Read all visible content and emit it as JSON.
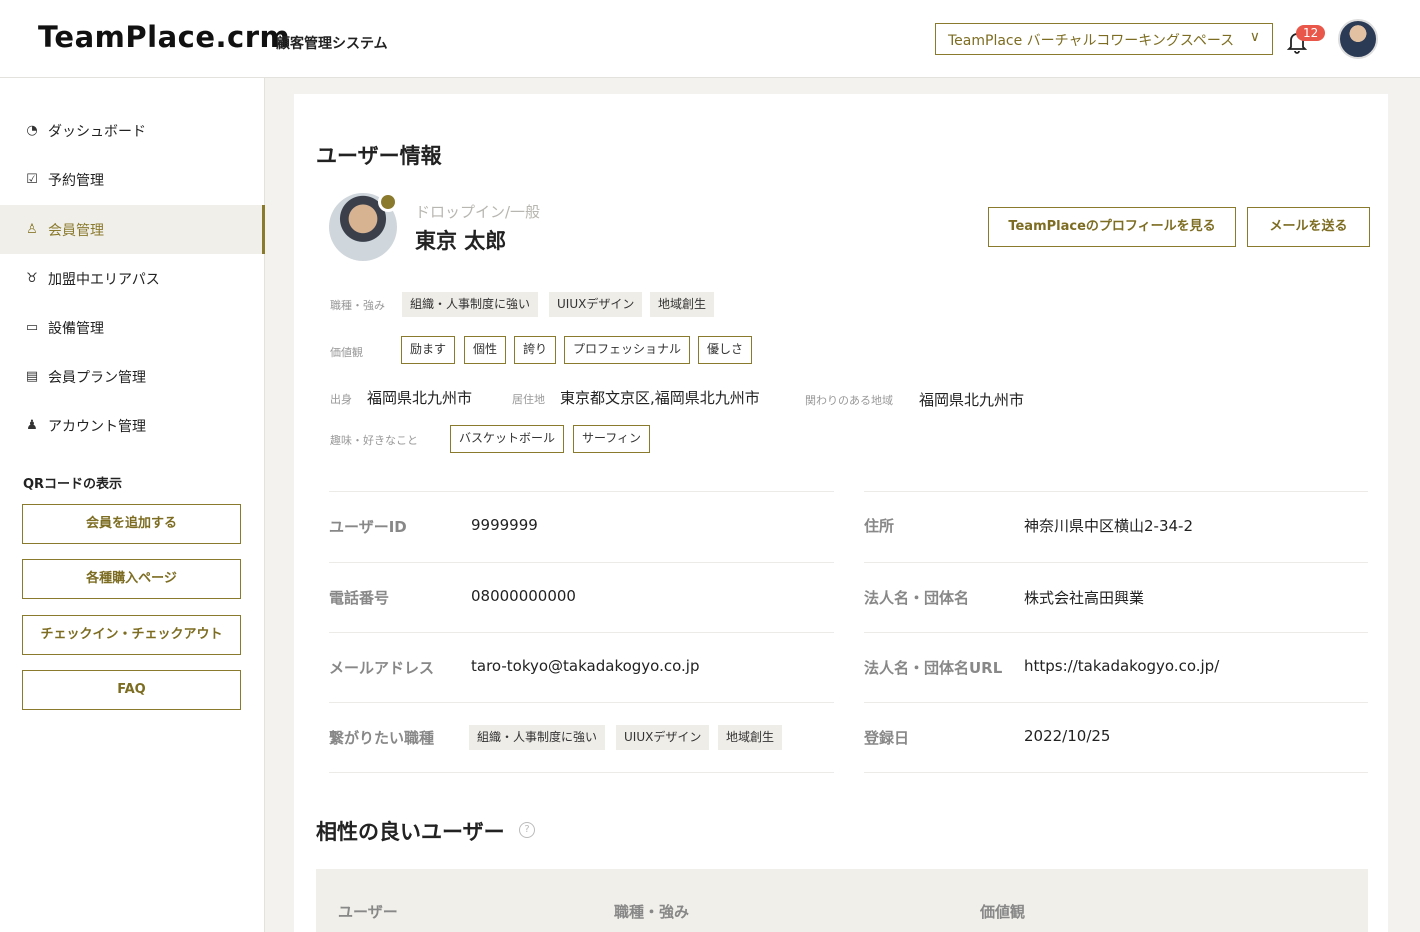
{
  "header": {
    "logo": "TeamPlace.crm",
    "subtitle": "顧客管理システム",
    "workspace_select": "TeamPlace バーチャルコワーキングスペース",
    "notification_count": "12"
  },
  "sidebar": {
    "items": [
      {
        "label": "ダッシュボード",
        "icon": "chart-icon"
      },
      {
        "label": "予約管理",
        "icon": "calendar-check-icon"
      },
      {
        "label": "会員管理",
        "icon": "members-icon"
      },
      {
        "label": "加盟中エリアパス",
        "icon": "award-icon"
      },
      {
        "label": "設備管理",
        "icon": "monitor-icon"
      },
      {
        "label": "会員プラン管理",
        "icon": "list-icon"
      },
      {
        "label": "アカウント管理",
        "icon": "account-icon"
      }
    ],
    "qr_title": "QRコードの表示",
    "buttons": [
      "会員を追加する",
      "各種購入ページ",
      "チェックイン・チェックアウト",
      "FAQ"
    ]
  },
  "main": {
    "title": "ユーザー情報",
    "role": "ドロップイン/一般",
    "name": "東京 太郎",
    "btn_profile": "TeamPlaceのプロフィールを見る",
    "btn_mail": "メールを送る",
    "skills_label": "職種・強み",
    "skills": [
      "組織・人事制度に強い",
      "UIUXデザイン",
      "地域創生"
    ],
    "values_label": "価値観",
    "values": [
      "励ます",
      "個性",
      "誇り",
      "プロフェッショナル",
      "優しさ"
    ],
    "origin_label": "出身",
    "origin": "福岡県北九州市",
    "residence_label": "居住地",
    "residence": "東京都文京区,福岡県北九州市",
    "region_label": "関わりのある地域",
    "region": "福岡県北九州市",
    "hobby_label": "趣味・好きなこと",
    "hobbies": [
      "バスケットボール",
      "サーフィン"
    ],
    "fields_left": [
      {
        "label": "ユーザーID",
        "value": "9999999"
      },
      {
        "label": "電話番号",
        "value": "08000000000"
      },
      {
        "label": "メールアドレス",
        "value": "taro-tokyo@takadakogyo.co.jp"
      },
      {
        "label": "繋がりたい職種",
        "value": ""
      }
    ],
    "connect_chips": [
      "組織・人事制度に強い",
      "UIUXデザイン",
      "地域創生"
    ],
    "fields_right": [
      {
        "label": "住所",
        "value": "神奈川県中区横山2-34-2"
      },
      {
        "label": "法人名・団体名",
        "value": "株式会社高田興業"
      },
      {
        "label": "法人名・団体名URL",
        "value": "https://takadakogyo.co.jp/"
      },
      {
        "label": "登録日",
        "value": "2022/10/25"
      }
    ],
    "compat_title": "相性の良いユーザー",
    "table_headers": [
      "ユーザー",
      "職種・強み",
      "価値観"
    ]
  },
  "colors": {
    "accent": "#8a7a2e",
    "badge": "#e8574a",
    "chip_bg": "#efede8"
  }
}
